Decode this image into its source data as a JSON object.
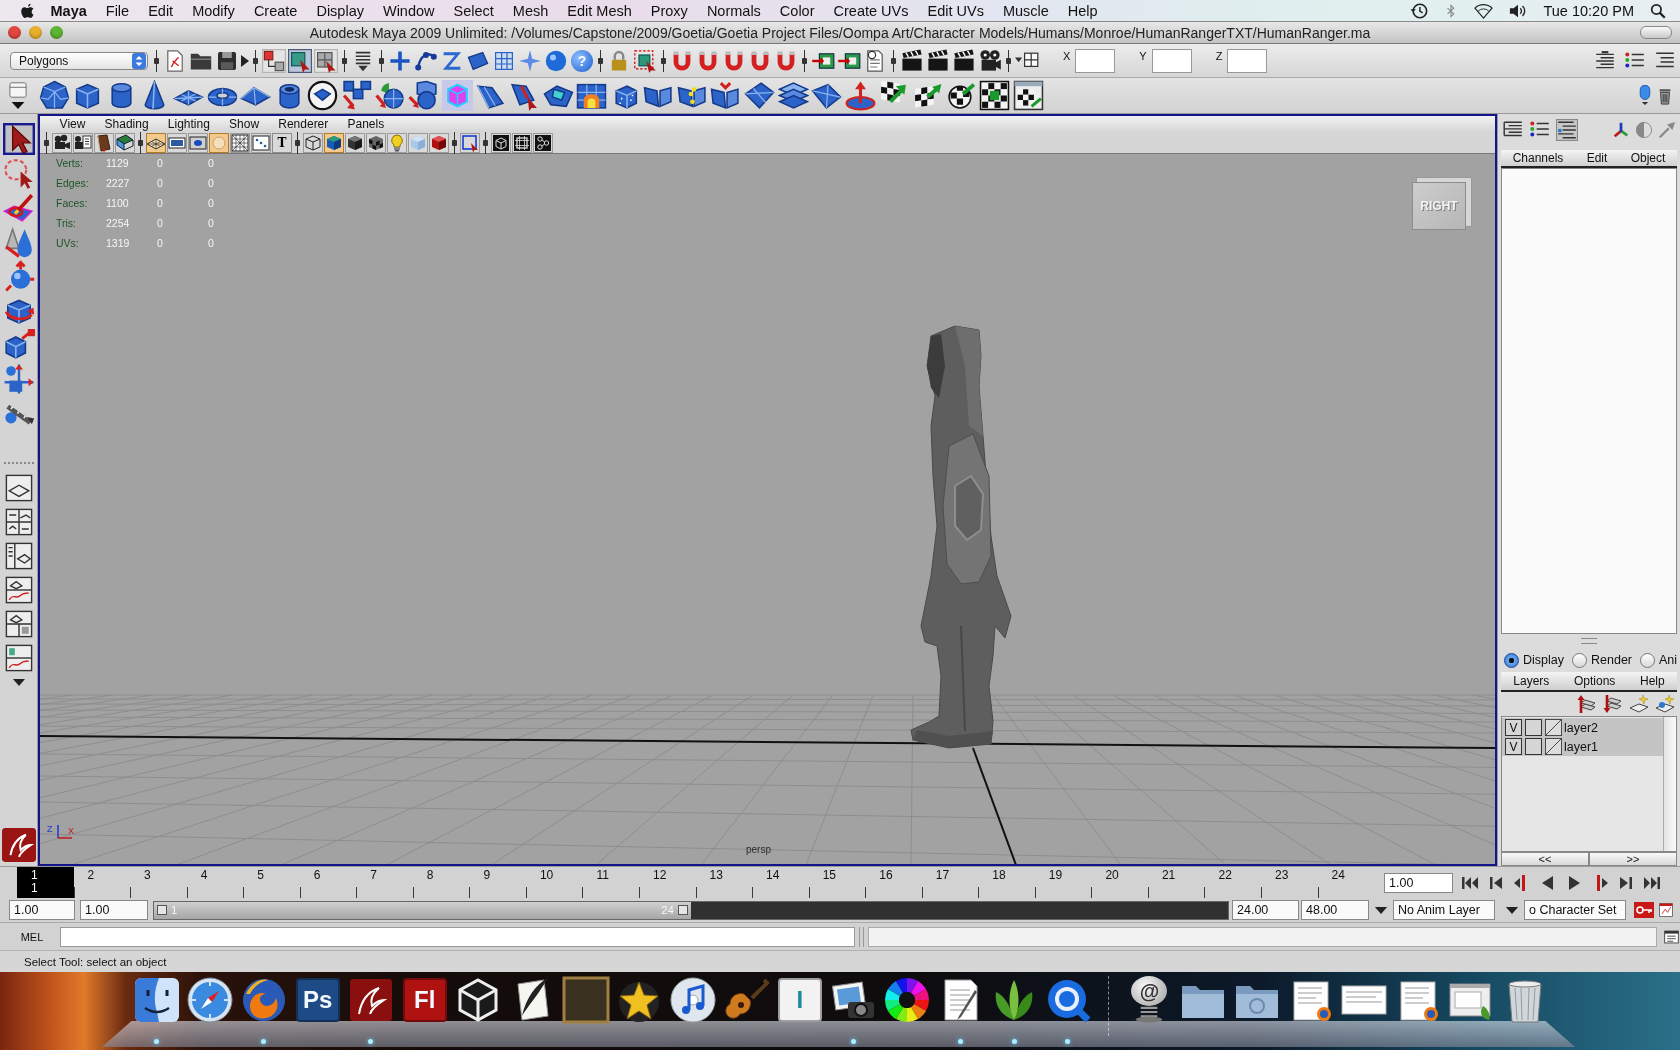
{
  "menu_bar": {
    "app": "Maya",
    "items": [
      "File",
      "Edit",
      "Modify",
      "Create",
      "Display",
      "Window",
      "Select",
      "Mesh",
      "Edit Mesh",
      "Proxy",
      "Normals",
      "Color",
      "Create UVs",
      "Edit UVs",
      "Muscle",
      "Help"
    ],
    "clock": "Tue 10:20 PM"
  },
  "window": {
    "title": "Autodesk Maya 2009 Unlimited: /Volumes/Capstone/2009/Goetia/Goetia Project Files/Oompa Art/Character Models/Humans/Monroe/HumanRangerTXT/HumanRanger.ma"
  },
  "status_line": {
    "menu_set": "Polygons",
    "selection_modes": [
      {
        "selected": false
      },
      {
        "selected": true
      },
      {
        "selected": false
      }
    ],
    "help_button": "?",
    "coordinate_fields": [
      {
        "label": "X"
      },
      {
        "label": "Y"
      },
      {
        "label": "Z"
      }
    ]
  },
  "toolbox": {
    "tools": [
      {
        "kind": "select",
        "selected": true
      },
      {
        "kind": "lasso",
        "selected": false
      },
      {
        "kind": "paint",
        "selected": false
      },
      {
        "kind": "last",
        "selected": false
      },
      {
        "kind": "move",
        "selected": false
      },
      {
        "kind": "rotate",
        "selected": false
      },
      {
        "kind": "scale",
        "selected": false
      },
      {
        "kind": "universal",
        "selected": false
      },
      {
        "kind": "manip",
        "selected": false
      }
    ]
  },
  "viewport": {
    "menus": [
      "View",
      "Shading",
      "Lighting",
      "Show",
      "Renderer",
      "Panels"
    ],
    "toolbar_groups": [
      {
        "buttons": [
          {
            "kind": "camera",
            "on": false
          },
          {
            "kind": "camera_notes",
            "on": false
          },
          {
            "kind": "book",
            "on": false
          },
          {
            "kind": "image_plane",
            "on": false
          }
        ]
      },
      {
        "buttons": [
          {
            "kind": "grid",
            "on": true
          },
          {
            "kind": "film_gate",
            "on": false
          },
          {
            "kind": "res_gate",
            "on": false
          },
          {
            "kind": "circle",
            "on": true
          },
          {
            "kind": "field_chart",
            "on": false
          },
          {
            "kind": "safe",
            "on": false
          },
          {
            "kind": "text",
            "label": "T",
            "on": false
          }
        ]
      },
      {
        "buttons": [
          {
            "kind": "wire_cube",
            "on": false
          },
          {
            "kind": "shaded_cube",
            "on": true
          },
          {
            "kind": "solid_cube",
            "on": false
          },
          {
            "kind": "checker_cube",
            "on": false
          },
          {
            "kind": "bulb",
            "on": false
          },
          {
            "kind": "pale_cube",
            "on": false
          },
          {
            "kind": "red_cube",
            "on": false
          }
        ]
      },
      {
        "buttons": [
          {
            "kind": "frame_sel",
            "on": false
          }
        ]
      },
      {
        "buttons": [
          {
            "kind": "isolate",
            "on": false
          },
          {
            "kind": "xray",
            "on": false
          },
          {
            "kind": "nodes",
            "on": false
          }
        ]
      }
    ],
    "hud": [
      {
        "label": "Verts:",
        "values": [
          "1129",
          "0",
          "0"
        ]
      },
      {
        "label": "Edges:",
        "values": [
          "2227",
          "0",
          "0"
        ]
      },
      {
        "label": "Faces:",
        "values": [
          "1100",
          "0",
          "0"
        ]
      },
      {
        "label": "Tris:",
        "values": [
          "2254",
          "0",
          "0"
        ]
      },
      {
        "label": "UVs:",
        "values": [
          "1319",
          "0",
          "0"
        ]
      }
    ],
    "view_cube": "RIGHT",
    "camera": "persp",
    "axis_labels": [
      "Z",
      "X"
    ]
  },
  "channel_box": {
    "view_buttons": [
      {
        "selected": false
      },
      {
        "selected": false
      },
      {
        "selected": true
      }
    ],
    "menus": [
      "Channels",
      "Edit",
      "Object"
    ]
  },
  "layer_editor": {
    "modes": [
      {
        "label": "Display",
        "selected": true
      },
      {
        "label": "Render",
        "selected": false
      },
      {
        "label": "Ani",
        "selected": false
      }
    ],
    "menus": [
      "Layers",
      "Options",
      "Help"
    ],
    "layers": [
      {
        "visibility": "V",
        "name": "layer2"
      },
      {
        "visibility": "V",
        "name": "layer1"
      }
    ],
    "scroll_buttons": [
      "<<",
      ">>"
    ]
  },
  "time_slider": {
    "frames": [
      {
        "label": "1",
        "selected": true
      },
      {
        "label": "2",
        "selected": false
      },
      {
        "label": "3",
        "selected": false
      },
      {
        "label": "4",
        "selected": false
      },
      {
        "label": "5",
        "selected": false
      },
      {
        "label": "6",
        "selected": false
      },
      {
        "label": "7",
        "selected": false
      },
      {
        "label": "8",
        "selected": false
      },
      {
        "label": "9",
        "selected": false
      },
      {
        "label": "10",
        "selected": false
      },
      {
        "label": "11",
        "selected": false
      },
      {
        "label": "12",
        "selected": false
      },
      {
        "label": "13",
        "selected": false
      },
      {
        "label": "14",
        "selected": false
      },
      {
        "label": "15",
        "selected": false
      },
      {
        "label": "16",
        "selected": false
      },
      {
        "label": "17",
        "selected": false
      },
      {
        "label": "18",
        "selected": false
      },
      {
        "label": "19",
        "selected": false
      },
      {
        "label": "20",
        "selected": false
      },
      {
        "label": "21",
        "selected": false
      },
      {
        "label": "22",
        "selected": false
      },
      {
        "label": "23",
        "selected": false
      },
      {
        "label": "24",
        "selected": false
      }
    ],
    "current_frame": "1",
    "current_time": "1.00"
  },
  "range_slider": {
    "start_time": "1.00",
    "playback_start": "1.00",
    "range_start": "1",
    "range_end": "24",
    "level": 0.5,
    "playback_end": "24.00",
    "end_time": "48.00",
    "anim_layer": "No Anim Layer",
    "character_set": "o Character Set"
  },
  "command_line": {
    "language": "MEL"
  },
  "help_line": {
    "text": "Select Tool: select an object"
  },
  "dock": {
    "apps": [
      {
        "kind": "finder",
        "running": true
      },
      {
        "kind": "compass",
        "running": false
      },
      {
        "kind": "globe",
        "running": true
      },
      {
        "kind": "tile",
        "label": "Ps",
        "color": "#1e4a86",
        "running": false
      },
      {
        "kind": "swirl",
        "running": true
      },
      {
        "kind": "tile",
        "label": "Fl",
        "color": "#b01212",
        "running": false
      },
      {
        "kind": "cube",
        "running": false
      },
      {
        "kind": "quill",
        "running": false
      },
      {
        "kind": "portrait",
        "running": false
      },
      {
        "kind": "star",
        "running": false
      },
      {
        "kind": "disc",
        "running": false
      },
      {
        "kind": "guitar",
        "running": false
      },
      {
        "kind": "tile",
        "label": "I",
        "color": "#f2f2f2",
        "running": false
      },
      {
        "kind": "camera",
        "running": true
      },
      {
        "kind": "wheel",
        "running": false
      },
      {
        "kind": "document",
        "running": true
      },
      {
        "kind": "leaves",
        "running": true
      },
      {
        "kind": "ring",
        "running": true
      }
    ],
    "stacks": [
      {
        "kind": "spring",
        "label": "@"
      },
      {
        "kind": "folder"
      },
      {
        "kind": "folder_emblem"
      },
      {
        "kind": "docs"
      },
      {
        "kind": "docw"
      },
      {
        "kind": "docs"
      },
      {
        "kind": "win"
      },
      {
        "kind": "trash"
      }
    ]
  }
}
